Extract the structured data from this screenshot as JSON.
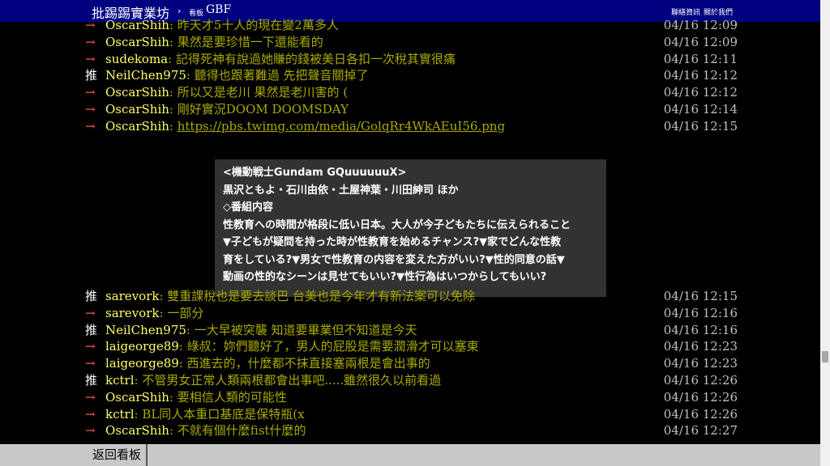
{
  "topbar": {
    "site_title": "批踢踢實業坊",
    "separator": "›",
    "board_label": "看板",
    "board_name": "GBF",
    "links": [
      "聯絡資訊",
      "關於我們"
    ]
  },
  "pushes_top": [
    {
      "tag": "→",
      "tag_type": "arrow",
      "user": "OscarShih",
      "content": ": 昨天才5十人的現在變2萬多人",
      "time": "04/16 12:09"
    },
    {
      "tag": "→",
      "tag_type": "arrow",
      "user": "OscarShih",
      "content": ": 果然是要珍惜一下還能看的",
      "time": "04/16 12:09"
    },
    {
      "tag": "→",
      "tag_type": "arrow",
      "user": "sudekoma",
      "content": ": 記得死神有說過她賺的錢被美日各扣一次稅其實很痛",
      "time": "04/16 12:11"
    },
    {
      "tag": "推",
      "tag_type": "good",
      "user": "NeilChen975",
      "content": ": 聽得也跟著難過 先把聲音關掉了",
      "time": "04/16 12:12"
    },
    {
      "tag": "→",
      "tag_type": "arrow",
      "user": "OscarShih",
      "content": ": 所以又是老川 果然是老川害的 (",
      "time": "04/16 12:12"
    },
    {
      "tag": "→",
      "tag_type": "arrow",
      "user": "OscarShih",
      "content": ": 剛好實況DOOM DOOMSDAY",
      "time": "04/16 12:14"
    },
    {
      "tag": "→",
      "tag_type": "arrow",
      "user": "OscarShih",
      "content": ": ",
      "link": "https://pbs.twimg.com/media/GolqRr4WkAEuI56.png",
      "time": "04/16 12:15"
    }
  ],
  "preview": {
    "lines": [
      "<機動戦士Gundam GQuuuuuuX>",
      "黒沢ともよ・石川由依・土屋神葉・川田紳司 ほか",
      "◇番組内容",
      "性教育への時間が格段に低い日本。大人が今子どもたちに伝えられること",
      "▼子どもが疑問を持った時が性教育を始めるチャンス?▼家でどんな性教",
      "育をしている?▼男女で性教育の内容を変えた方がいい?▼性的同意の話▼",
      "動画の性的なシーンは見せてもいい?▼性行為はいつからしてもいい?"
    ]
  },
  "pushes_bottom": [
    {
      "tag": "推",
      "tag_type": "good",
      "user": "sarevork",
      "content": ": 雙重課稅也是要去談巴 台美也是今年才有新法案可以免除",
      "time": "04/16 12:15"
    },
    {
      "tag": "→",
      "tag_type": "arrow",
      "user": "sarevork",
      "content": ": 一部分",
      "time": "04/16 12:16"
    },
    {
      "tag": "推",
      "tag_type": "good",
      "user": "NeilChen975",
      "content": ": 一大早被突襲 知道要畢業但不知道是今天",
      "time": "04/16 12:16"
    },
    {
      "tag": "→",
      "tag_type": "arrow",
      "user": "laigeorge89",
      "content": ": 綠叔：妳們聽好了，男人的屁股是需要潤滑才可以塞東",
      "time": "04/16 12:23"
    },
    {
      "tag": "→",
      "tag_type": "arrow",
      "user": "laigeorge89",
      "content": ": 西進去的，什麼都不抹直接塞兩根是會出事的",
      "time": "04/16 12:23"
    },
    {
      "tag": "推",
      "tag_type": "good",
      "user": "kctrl",
      "content": ": 不管男女正常人類兩根都會出事吧.....雖然很久以前看過",
      "time": "04/16 12:26"
    },
    {
      "tag": "→",
      "tag_type": "arrow",
      "user": "OscarShih",
      "content": ": 要相信人類的可能性",
      "time": "04/16 12:26"
    },
    {
      "tag": "→",
      "tag_type": "arrow",
      "user": "kctrl",
      "content": ": BL同人本重口基底是保特瓶(x",
      "time": "04/16 12:26"
    },
    {
      "tag": "→",
      "tag_type": "arrow",
      "user": "OscarShih",
      "content": ": 不就有個什麼fist什麼的",
      "time": "04/16 12:27"
    }
  ],
  "bottombar": {
    "back_label": "返回看板"
  }
}
